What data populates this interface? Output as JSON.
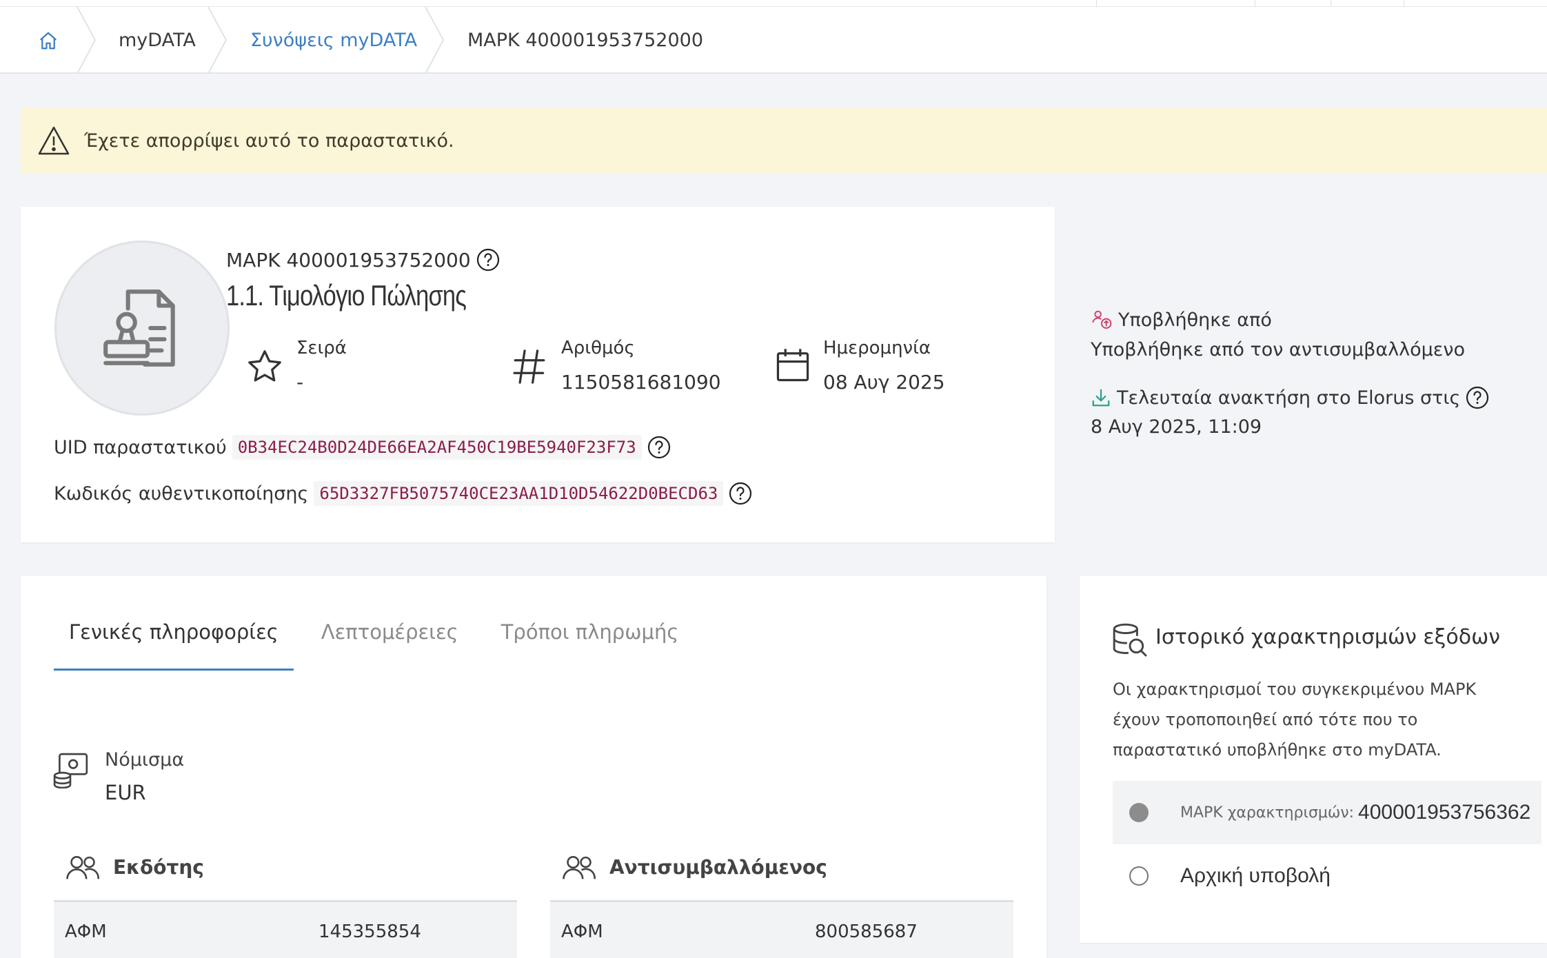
{
  "breadcrumb": {
    "items": [
      "myDATA",
      "Συνόψεις myDATA",
      "ΜΑΡΚ 400001953752000"
    ]
  },
  "alert": {
    "text": "Έχετε απορρίψει αυτό το παραστατικό."
  },
  "document": {
    "mark": "ΜΑΡΚ 400001953752000",
    "type": "1.1. Τιμολόγιο Πώλησης",
    "series_label": "Σειρά",
    "series_value": "-",
    "number_label": "Αριθμός",
    "number_value": "1150581681090",
    "date_label": "Ημερομηνία",
    "date_value": "08 Αυγ 2025",
    "uid_label": "UID παραστατικού",
    "uid_value": "0B34EC24B0D24DE66EA2AF450C19BE5940F23F73",
    "auth_label": "Κωδικός αυθεντικοποίησης",
    "auth_value": "65D3327FB5075740CE23AA1D10D54622D0BECD63"
  },
  "side": {
    "submitted_label": "Υποβλήθηκε από",
    "submitted_value": "Υποβλήθηκε από τον αντισυμβαλλόμενο",
    "retrieved_label": "Τελευταία ανακτήση στο Elorus στις",
    "retrieved_value": "8 Αυγ 2025, 11:09"
  },
  "tabs": [
    "Γενικές πληροφορίες",
    "Λεπτομέρειες",
    "Τρόποι πληρωμής"
  ],
  "currency": {
    "label": "Νόμισμα",
    "value": "EUR"
  },
  "issuer": {
    "title": "Εκδότης",
    "afm_label": "ΑΦΜ",
    "afm_value": "145355854"
  },
  "counterparty": {
    "title": "Αντισυμβαλλόμενος",
    "afm_label": "ΑΦΜ",
    "afm_value": "800585687"
  },
  "history": {
    "title": "Ιστορικό χαρακτηρισμών εξόδων",
    "description": "Οι χαρακτηρισμοί του συγκεκριμένου ΜΑΡΚ έχουν τροποποιηθεί από τότε που το παραστατικό υποβλήθηκε στο myDATA.",
    "entry_label": "ΜΑΡΚ χαρακτηρισμών:",
    "entry_value": "400001953756362",
    "original_label": "Αρχική υποβολή"
  },
  "colors": {
    "accent": "#3c7fc4",
    "alert_bg": "#fbf6d8",
    "code_text": "#8a1d4a"
  }
}
